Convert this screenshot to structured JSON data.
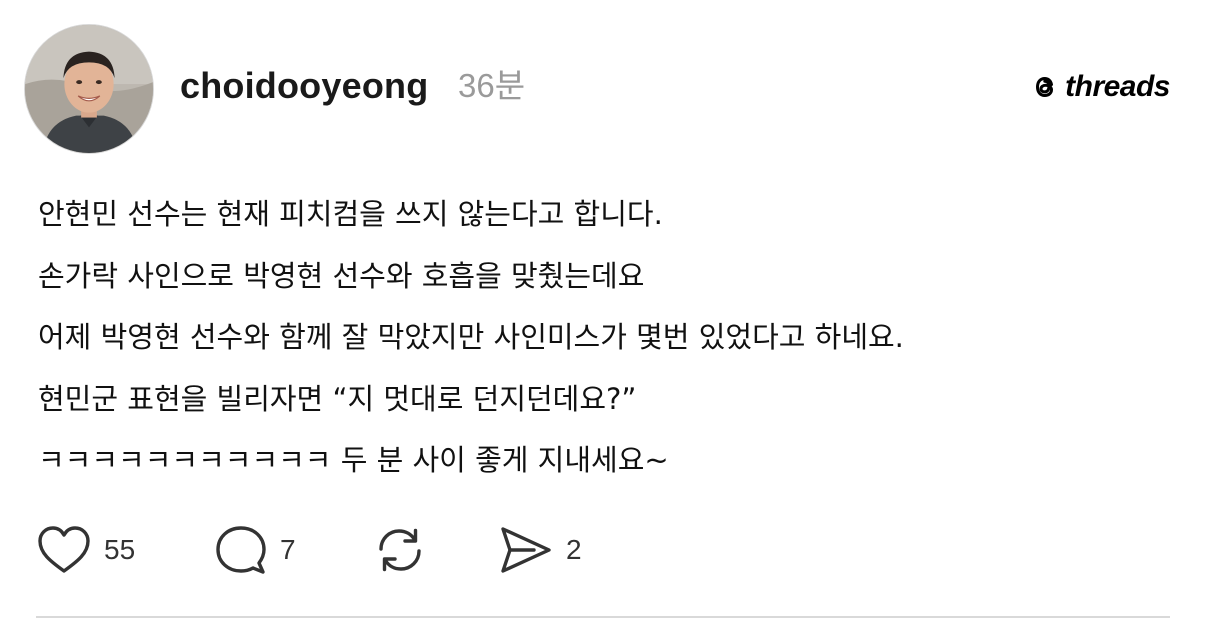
{
  "post": {
    "author": "choidooyeong",
    "time_ago": "36분",
    "brand": "threads",
    "avatar_icon": "profile-photo",
    "lines": [
      "안현민 선수는 현재 피치컴을 쓰지 않는다고 합니다.",
      "손가락 사인으로 박영현 선수와 호흡을 맞췄는데요",
      "어제 박영현 선수와 함께 잘 막았지만 사인미스가 몇번 있었다고 하네요.",
      "현민군 표현을 빌리자면 “지 멋대로 던지던데요?”",
      "ㅋㅋㅋㅋㅋㅋㅋㅋㅋㅋㅋ 두 분 사이 좋게 지내세요~"
    ]
  },
  "actions": {
    "like_count": "55",
    "reply_count": "7",
    "share_count": "2",
    "icons": [
      "heart-icon",
      "comment-icon",
      "repost-icon",
      "share-icon"
    ]
  },
  "colors": {
    "text": "#111111",
    "muted": "#9a9a9a",
    "icon": "#333333",
    "divider": "#d9d9d9"
  }
}
